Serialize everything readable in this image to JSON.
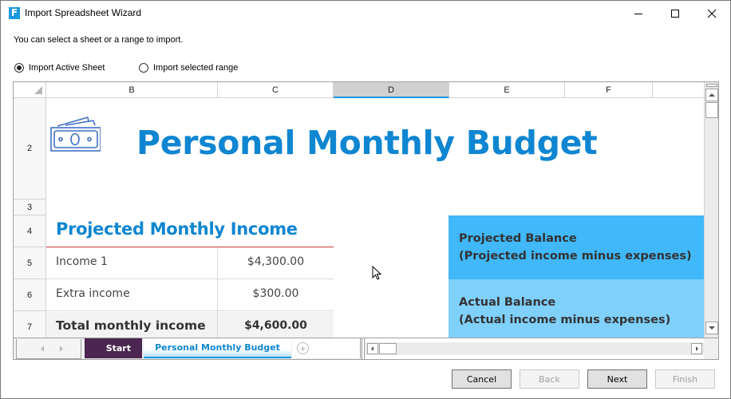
{
  "window": {
    "title": "Import Spreadsheet Wizard",
    "app_icon_letter": "F",
    "controls": [
      "minimize",
      "maximize",
      "close"
    ]
  },
  "instruction": "You can select a sheet or a range to import.",
  "import_options": [
    {
      "label": "Import Active Sheet",
      "checked": true
    },
    {
      "label": "Import selected range",
      "checked": false
    }
  ],
  "spreadsheet": {
    "columns": [
      "B",
      "C",
      "D",
      "E",
      "F"
    ],
    "selected_column": "D",
    "rows": [
      "2",
      "3",
      "4",
      "5",
      "6",
      "7"
    ],
    "title": "Personal Monthly Budget",
    "title_icon": "money-bills-icon",
    "income_section": {
      "title": "Projected Monthly Income",
      "items": [
        {
          "label": "Income 1",
          "value": "$4,300.00"
        },
        {
          "label": "Extra income",
          "value": "$300.00"
        },
        {
          "label": "Total monthly income",
          "value": "$4,600.00",
          "bold": true
        }
      ]
    },
    "balances": [
      {
        "title": "Projected Balance",
        "subtitle": "(Projected income minus expenses)",
        "color": "#40b8f9"
      },
      {
        "title": "Actual Balance",
        "subtitle": "(Actual income minus expenses)",
        "color": "#80d0fc"
      }
    ],
    "tabs": [
      {
        "label": "Start",
        "active": false,
        "color": "#4b2650"
      },
      {
        "label": "Personal Monthly Budget",
        "active": true
      }
    ],
    "add_tab_icon": "+"
  },
  "buttons": {
    "cancel": "Cancel",
    "back": "Back",
    "next": "Next",
    "finish": "Finish"
  },
  "colors": {
    "accent": "#1a98e0",
    "title_blue": "#0f86d1",
    "divider_red": "#c8383a"
  }
}
